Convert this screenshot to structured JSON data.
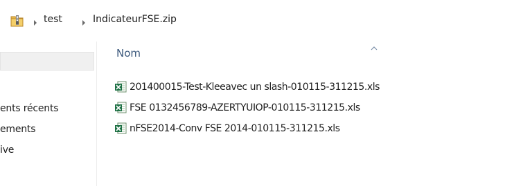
{
  "addressbar": {
    "crumbs": [
      "test",
      "IndicateurFSE.zip"
    ]
  },
  "navpane": {
    "items": [
      {
        "label": "ents récents"
      },
      {
        "label": "ements"
      },
      {
        "label": "ive"
      }
    ]
  },
  "content": {
    "column_header": "Nom",
    "files": [
      {
        "name": "201400015-Test-Kleeavec un slash-010115-311215.xls",
        "icon": "excel-file-icon"
      },
      {
        "name": "FSE 0132456789-AZERTYUIOP-010115-311215.xls",
        "icon": "excel-file-icon"
      },
      {
        "name": "nFSE2014-Conv FSE 2014-010115-311215.xls",
        "icon": "excel-file-icon"
      }
    ]
  },
  "icons": {
    "folder": "zip-folder-icon",
    "separator": "chevron-right-icon",
    "sort": "sort-ascending-icon"
  },
  "colors": {
    "header_text": "#3d5a7d",
    "excel_green": "#1e7145"
  }
}
